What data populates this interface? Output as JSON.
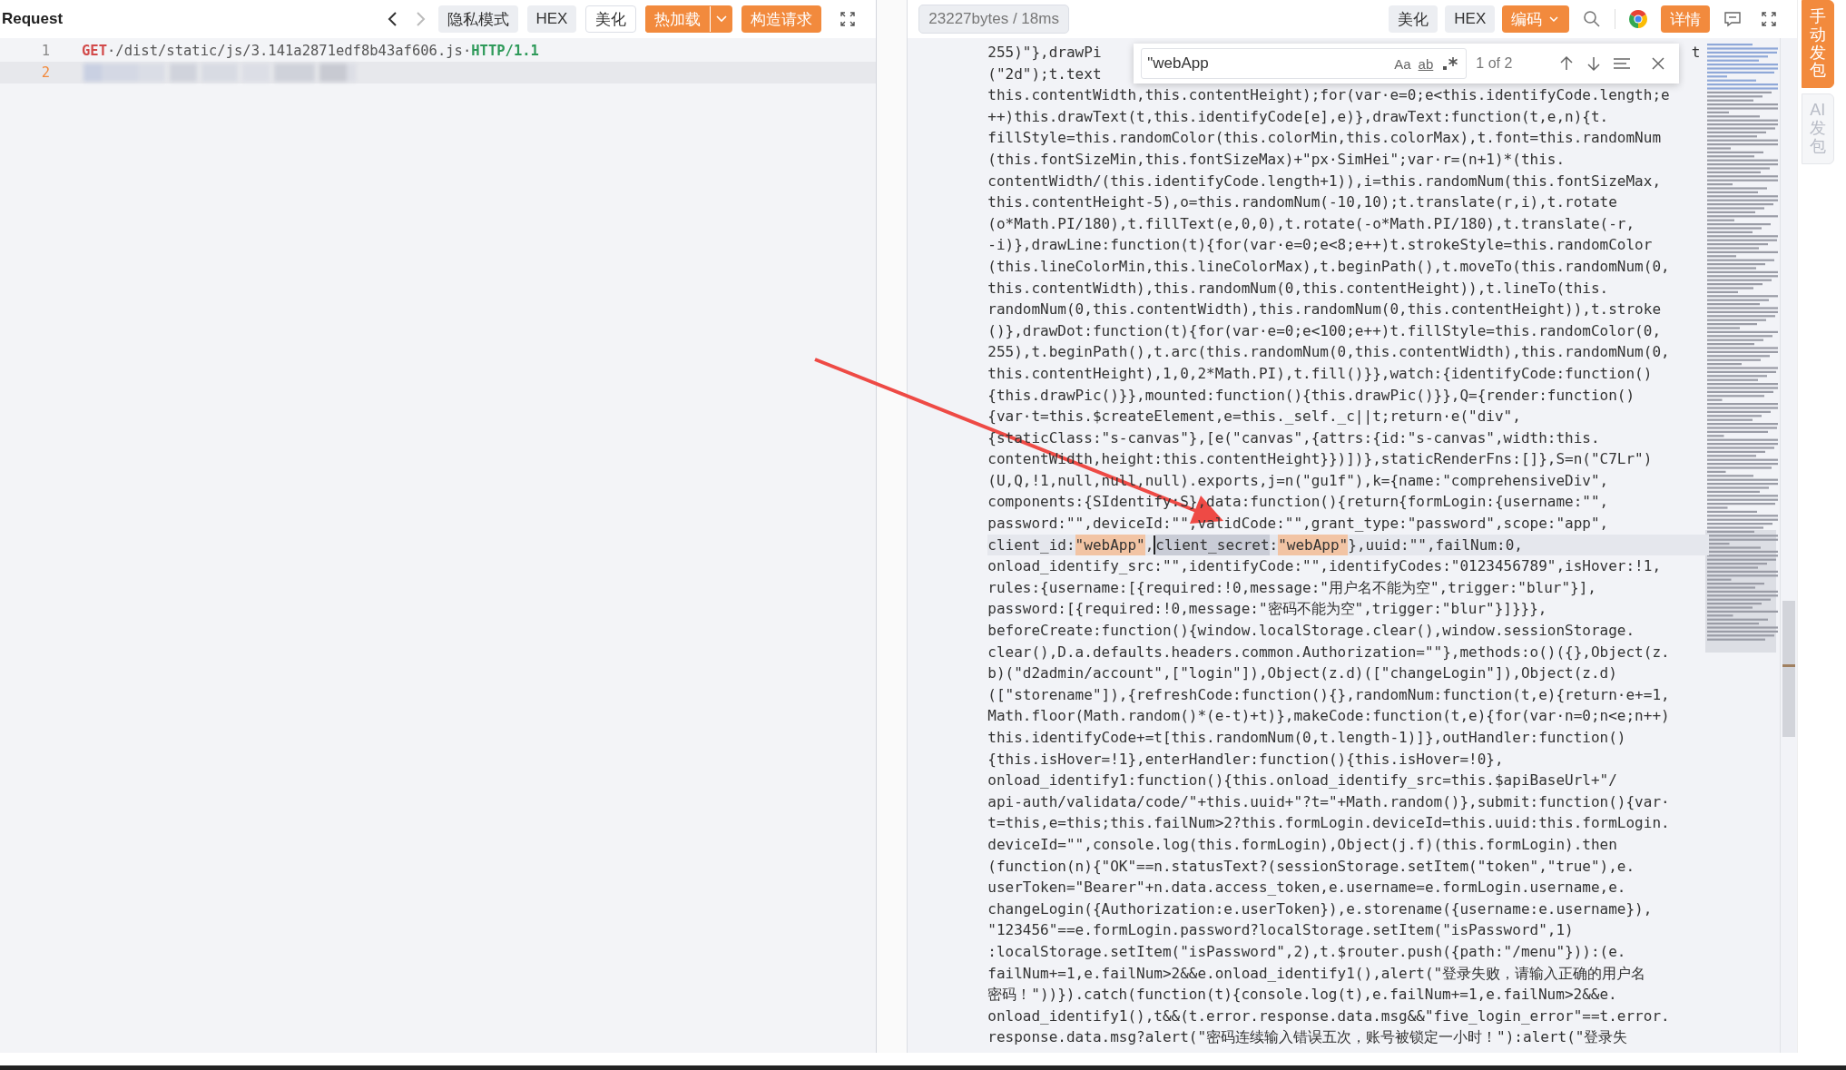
{
  "request_panel": {
    "title": "Request",
    "nav": [
      {
        "disabled": false
      },
      {
        "disabled": true
      }
    ],
    "buttons": [
      {
        "label": "隐私模式",
        "kind": "plain"
      },
      {
        "label": "HEX",
        "kind": "plain"
      },
      {
        "label": "美化",
        "kind": "outline"
      },
      {
        "label": "热加载",
        "kind": "split"
      },
      {
        "label": "构造请求",
        "kind": "primary"
      }
    ],
    "lines": [
      {
        "number": "1",
        "current": false,
        "kind": "request",
        "method": "GET",
        "path": "·/dist/static/js/3.141a2871edf8b43af606.js·",
        "version": "HTTP/1.1"
      },
      {
        "number": "2",
        "current": true,
        "kind": "redacted"
      }
    ]
  },
  "response_panel": {
    "stats": "23227bytes / 18ms",
    "buttons": [
      {
        "label": "美化",
        "kind": "plain"
      },
      {
        "label": "HEX",
        "kind": "plain"
      },
      {
        "label": "编码",
        "kind": "dropdown"
      },
      {
        "label": "详情",
        "kind": "primary"
      }
    ],
    "find": {
      "value": "\"webApp",
      "match_case": "Aa",
      "whole_word": "ab",
      "result": "1 of 2"
    },
    "code": {
      "covered_lines": [
        {
          "text": "255)\"},drawPi",
          "tail": "t"
        },
        {
          "text": "(\"2d\");t.text"
        }
      ],
      "lines_above": [
        "this.contentWidth,this.contentHeight);for(var·e=0;e<this.identifyCode.length;e",
        "++)this.drawText(t,this.identifyCode[e],e)},drawText:function(t,e,n){t.",
        "fillStyle=this.randomColor(this.colorMin,this.colorMax),t.font=this.randomNum",
        "(this.fontSizeMin,this.fontSizeMax)+\"px·SimHei\";var·r=(n+1)*(this.",
        "contentWidth/(this.identifyCode.length+1)),i=this.randomNum(this.fontSizeMax,",
        "this.contentHeight-5),o=this.randomNum(-10,10);t.translate(r,i),t.rotate",
        "(o*Math.PI/180),t.fillText(e,0,0),t.rotate(-o*Math.PI/180),t.translate(-r,",
        "-i)},drawLine:function(t){for(var·e=0;e<8;e++)t.strokeStyle=this.randomColor",
        "(this.lineColorMin,this.lineColorMax),t.beginPath(),t.moveTo(this.randomNum(0,",
        "this.contentWidth),this.randomNum(0,this.contentHeight)),t.lineTo(this.",
        "randomNum(0,this.contentWidth),this.randomNum(0,this.contentHeight)),t.stroke",
        "()},drawDot:function(t){for(var·e=0;e<100;e++)t.fillStyle=this.randomColor(0,",
        "255),t.beginPath(),t.arc(this.randomNum(0,this.contentWidth),this.randomNum(0,",
        "this.contentHeight),1,0,2*Math.PI),t.fill()}},watch:{identifyCode:function()",
        "{this.drawPic()}},mounted:function(){this.drawPic()}},Q={render:function()",
        "{var·t=this.$createElement,e=this._self._c||t;return·e(\"div\",",
        "{staticClass:\"s-canvas\"},[e(\"canvas\",{attrs:{id:\"s-canvas\",width:this.",
        "contentWidth,height:this.contentHeight}})])},staticRenderFns:[]},S=n(\"C7Lr\")",
        "(U,Q,!1,null,null,null).exports,j=n(\"gu1f\"),k={name:\"comprehensiveDiv\",",
        "components:{SIdentify:S},data:function(){return{formLogin:{username:\"\",",
        "password:\"\",deviceId:\"\",validCode:\"\",grant_type:\"password\",scope:\"app\","
      ],
      "current_line": [
        {
          "kind": "text",
          "text": "client_id:"
        },
        {
          "kind": "match",
          "text": "\"webApp\""
        },
        {
          "kind": "text",
          "text": ","
        },
        {
          "kind": "cursor"
        },
        {
          "kind": "selected",
          "text": "client_secret"
        },
        {
          "kind": "text",
          "text": ":"
        },
        {
          "kind": "match",
          "text": "\"webApp\""
        },
        {
          "kind": "text",
          "text": "},uuid:\"\",failNum:0,"
        }
      ],
      "lines_below": [
        "onload_identify_src:\"\",identifyCode:\"\",identifyCodes:\"0123456789\",isHover:!1,",
        "rules:{username:[{required:!0,message:\"用户名不能为空\",trigger:\"blur\"}],",
        "password:[{required:!0,message:\"密码不能为空\",trigger:\"blur\"}]}}},",
        "beforeCreate:function(){window.localStorage.clear(),window.sessionStorage.",
        "clear(),D.a.defaults.headers.common.Authorization=\"\"},methods:o()({},Object(z.",
        "b)(\"d2admin/account\",[\"login\"]),Object(z.d)([\"changeLogin\"]),Object(z.d)",
        "([\"storename\"]),{refreshCode:function(){},randomNum:function(t,e){return·e+=1,",
        "Math.floor(Math.random()*(e-t)+t)},makeCode:function(t,e){for(var·n=0;n<e;n++)",
        "this.identifyCode+=t[this.randomNum(0,t.length-1)]},outHandler:function()",
        "{this.isHover=!1},enterHandler:function(){this.isHover=!0},",
        "onload_identify1:function(){this.onload_identify_src=this.$apiBaseUrl+\"/",
        "api-auth/validata/code/\"+this.uuid+\"?t=\"+Math.random()},submit:function(){var·",
        "t=this,e=this;this.failNum>2?this.formLogin.deviceId=this.uuid:this.formLogin.",
        "deviceId=\"\",console.log(this.formLogin),Object(j.f)(this.formLogin).then",
        "(function(n){\"OK\"==n.statusText?(sessionStorage.setItem(\"token\",\"true\"),e.",
        "userToken=\"Bearer\"+n.data.access_token,e.username=e.formLogin.username,e.",
        "changeLogin({Authorization:e.userToken}),e.storename({username:e.username}),",
        "\"123456\"==e.formLogin.password?localStorage.setItem(\"isPassword\",1)",
        ":localStorage.setItem(\"isPassword\",2),t.$router.push({path:\"/menu\"})):(e.",
        "failNum+=1,e.failNum>2&&e.onload_identify1(),alert(\"登录失败，请输入正确的用户名",
        "密码！\"))}).catch(function(t){console.log(t),e.failNum+=1,e.failNum>2&&e.",
        "onload_identify1(),t&&(t.error.response.data.msg&&\"five_login_error\"==t.error.",
        "response.data.msg?alert(\"密码连续输入错误五次，账号被锁定一小时！\"):alert(\"登录失"
      ]
    }
  },
  "side_tabs": [
    {
      "label": "手动发包",
      "selected": true
    },
    {
      "label": "AI发包",
      "selected": false
    }
  ]
}
